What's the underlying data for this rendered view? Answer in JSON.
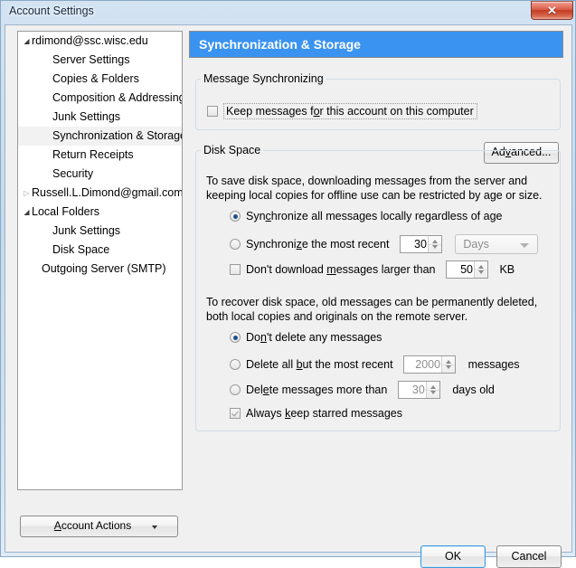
{
  "window": {
    "title": "Account Settings",
    "close_label": "✕"
  },
  "sidebar": {
    "items": [
      {
        "label": "rdimond@ssc.wisc.edu",
        "level": 0,
        "twisty": "open",
        "selected": false
      },
      {
        "label": "Server Settings",
        "level": 1,
        "twisty": "none",
        "selected": false
      },
      {
        "label": "Copies & Folders",
        "level": 1,
        "twisty": "none",
        "selected": false
      },
      {
        "label": "Composition & Addressing",
        "level": 1,
        "twisty": "none",
        "selected": false
      },
      {
        "label": "Junk Settings",
        "level": 1,
        "twisty": "none",
        "selected": false
      },
      {
        "label": "Synchronization & Storage",
        "level": 1,
        "twisty": "none",
        "selected": true
      },
      {
        "label": "Return Receipts",
        "level": 1,
        "twisty": "none",
        "selected": false
      },
      {
        "label": "Security",
        "level": 1,
        "twisty": "none",
        "selected": false
      },
      {
        "label": "Russell.L.Dimond@gmail.com",
        "level": 0,
        "twisty": "closed",
        "selected": false
      },
      {
        "label": "Local Folders",
        "level": 0,
        "twisty": "open",
        "selected": false
      },
      {
        "label": "Junk Settings",
        "level": 1,
        "twisty": "none",
        "selected": false
      },
      {
        "label": "Disk Space",
        "level": 1,
        "twisty": "none",
        "selected": false
      },
      {
        "label": "Outgoing Server (SMTP)",
        "level": 0,
        "twisty": "none",
        "selected": false
      }
    ],
    "account_actions_label": "Account Actions"
  },
  "panel": {
    "header_title": "Synchronization & Storage",
    "message_sync": {
      "legend": "Message Synchronizing",
      "keep_messages_label": "Keep messages for this account on this computer",
      "keep_messages_checked": false,
      "advanced_label": "Advanced..."
    },
    "disk_space": {
      "legend": "Disk Space",
      "intro_text": "To save disk space, downloading messages from the server and keeping local copies for offline use can be restricted by age or size.",
      "sync_all_label": "Synchronize all messages locally regardless of age",
      "sync_all_selected": true,
      "sync_recent_label": "Synchronize the most recent",
      "sync_recent_selected": false,
      "sync_recent_value": "30",
      "sync_recent_unit": "Days",
      "sync_recent_unit_disabled": true,
      "no_download_label": "Don't download messages larger than",
      "no_download_checked": false,
      "no_download_value": "50",
      "no_download_unit": "KB",
      "recover_text": "To recover disk space, old messages can be permanently deleted, both local copies and originals on the remote server.",
      "dont_delete_label": "Don't delete any messages",
      "dont_delete_selected": true,
      "delete_all_but_label": "Delete all but the most recent",
      "delete_all_but_selected": false,
      "delete_all_but_value": "2000",
      "delete_all_but_suffix": "messages",
      "delete_older_label": "Delete messages more than",
      "delete_older_selected": false,
      "delete_older_value": "30",
      "delete_older_suffix": "days old",
      "keep_starred_label": "Always keep starred messages",
      "keep_starred_checked": true
    }
  },
  "footer": {
    "ok_label": "OK",
    "cancel_label": "Cancel"
  },
  "colors": {
    "header_blue": "#3a93f0",
    "close_red": "#c33a22",
    "radio_dot": "#1c4f8c",
    "focus_blue": "#3c9bdd"
  }
}
